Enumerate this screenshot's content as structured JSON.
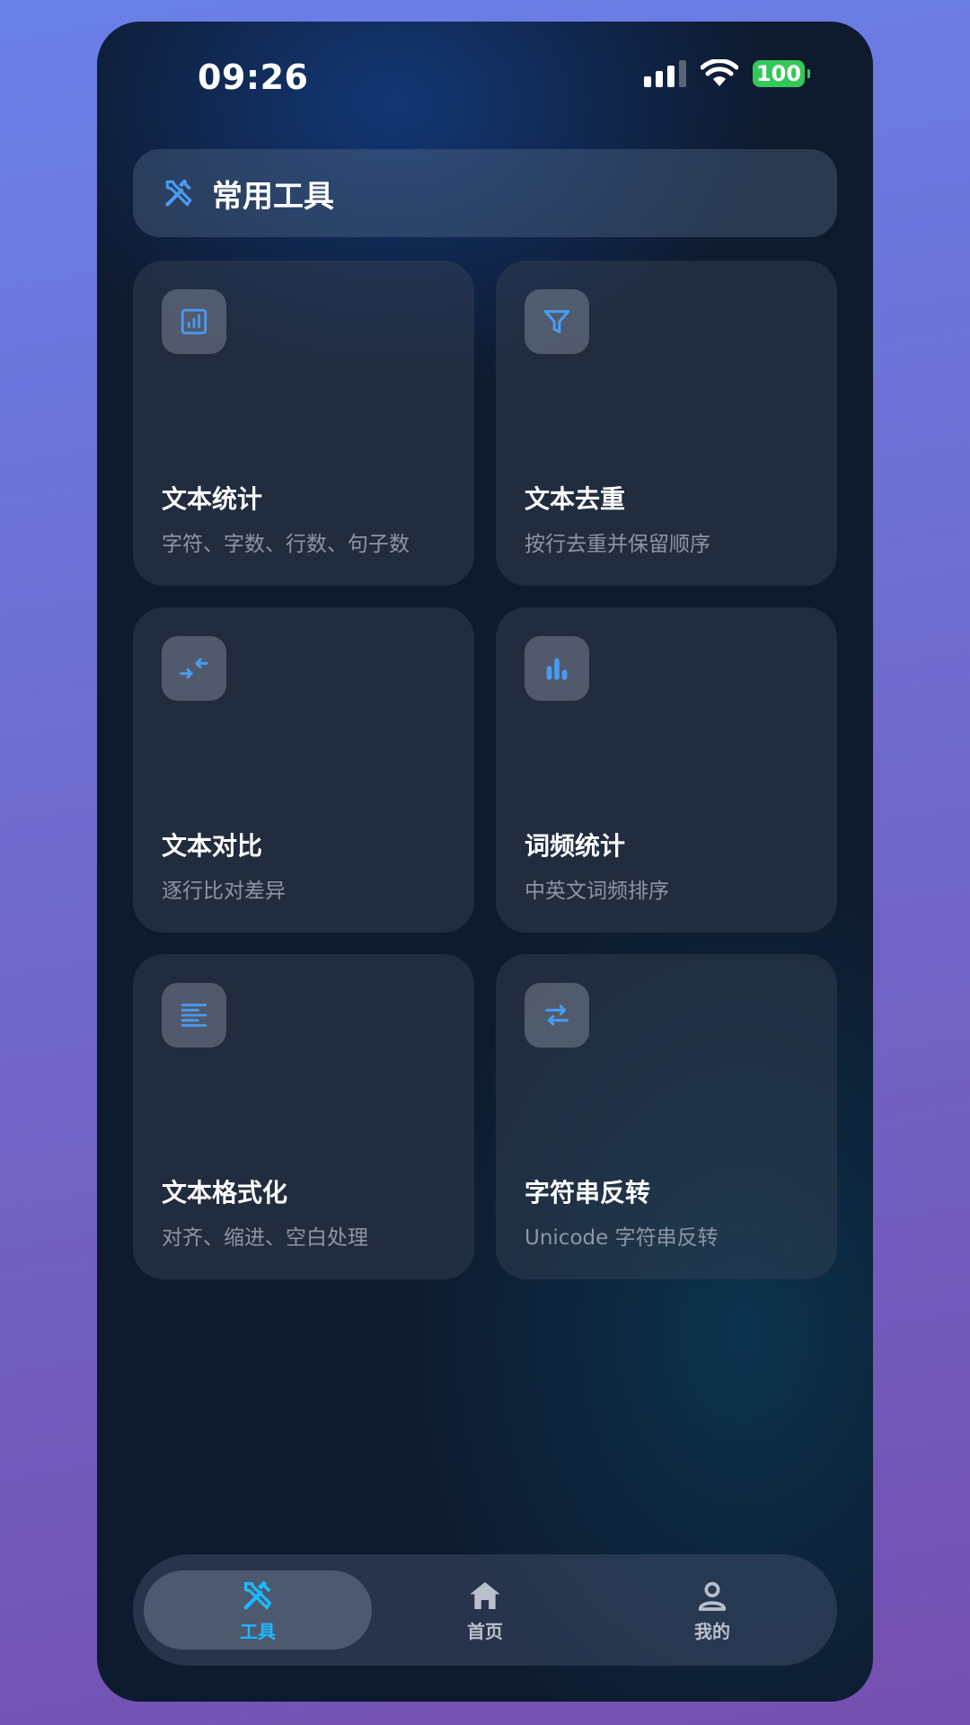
{
  "status_bar": {
    "time": "09:26",
    "battery": "100"
  },
  "header": {
    "title": "常用工具",
    "icon": "tools-icon"
  },
  "tools": [
    {
      "title": "文本统计",
      "desc": "字符、字数、行数、句子数",
      "icon": "stats-icon"
    },
    {
      "title": "文本去重",
      "desc": "按行去重并保留顺序",
      "icon": "filter-icon"
    },
    {
      "title": "文本对比",
      "desc": "逐行比对差异",
      "icon": "compare-arrows-icon"
    },
    {
      "title": "词频统计",
      "desc": "中英文词频排序",
      "icon": "bar-chart-icon"
    },
    {
      "title": "文本格式化",
      "desc": "对齐、缩进、空白处理",
      "icon": "align-left-icon"
    },
    {
      "title": "字符串反转",
      "desc": "Unicode 字符串反转",
      "icon": "swap-arrows-icon"
    }
  ],
  "tabbar": {
    "tabs": [
      {
        "label": "工具",
        "icon": "tools-icon",
        "active": true
      },
      {
        "label": "首页",
        "icon": "home-icon",
        "active": false
      },
      {
        "label": "我的",
        "icon": "user-icon",
        "active": false
      }
    ]
  },
  "colors": {
    "accent": "#4a9af0",
    "active_tab": "#1fb8ff",
    "battery": "#34c759"
  }
}
